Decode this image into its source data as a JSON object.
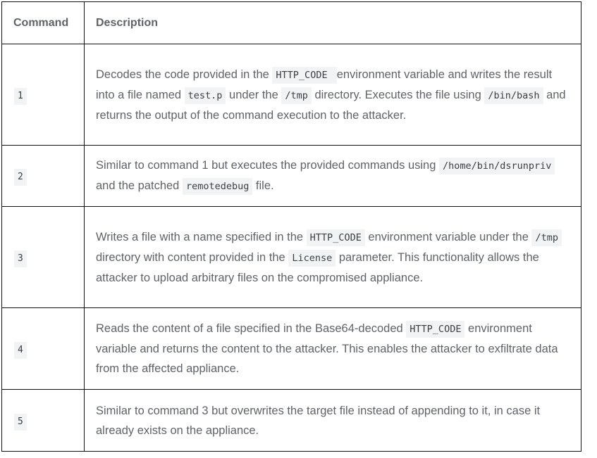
{
  "table": {
    "headers": {
      "command": "Command",
      "description": "Description"
    },
    "rows": [
      {
        "command": "1",
        "description": [
          {
            "t": "Decodes the code provided in the "
          },
          {
            "c": " HTTP_CODE "
          },
          {
            "t": " environment variable and writes the result into a file named "
          },
          {
            "c": "test.p"
          },
          {
            "t": " under the "
          },
          {
            "c": "/tmp"
          },
          {
            "t": " directory. Executes the file using "
          },
          {
            "c": "/bin/bash"
          },
          {
            "t": " and returns the output of the command execution to the attacker."
          }
        ]
      },
      {
        "command": "2",
        "description": [
          {
            "t": "Similar to command 1 but executes the provided commands using "
          },
          {
            "c": "/home/bin/dsrunpriv"
          },
          {
            "t": " and the patched "
          },
          {
            "c": "remotedebug"
          },
          {
            "t": " file."
          }
        ]
      },
      {
        "command": "3",
        "description": [
          {
            "t": "Writes a file with a name specified in the "
          },
          {
            "c": "HTTP_CODE"
          },
          {
            "t": " environment variable under the "
          },
          {
            "c": "/tmp"
          },
          {
            "t": " directory with content provided in the "
          },
          {
            "c": "License"
          },
          {
            "t": " parameter. This functionality allows the attacker to upload arbitrary files on the compromised appliance."
          }
        ]
      },
      {
        "command": "4",
        "description": [
          {
            "t": "Reads the content of a file specified in the Base64-decoded "
          },
          {
            "c": "HTTP_CODE"
          },
          {
            "t": " environment variable and returns the content to the attacker. This enables the attacker to exfiltrate data from the affected appliance."
          }
        ]
      },
      {
        "command": "5",
        "description": [
          {
            "t": "Similar to command 3 but overwrites the target file instead of appending to it, in case it already exists on the appliance."
          }
        ]
      }
    ]
  }
}
